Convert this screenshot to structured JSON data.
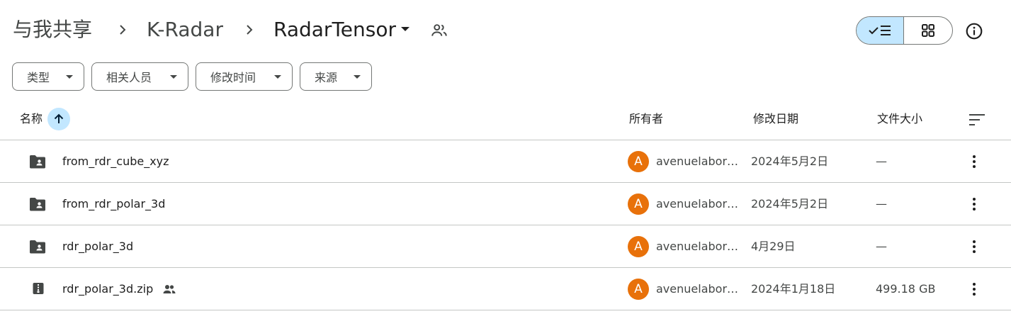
{
  "breadcrumb": {
    "items": [
      {
        "label": "与我共享"
      },
      {
        "label": "K-Radar"
      },
      {
        "label": "RadarTensor"
      }
    ]
  },
  "view_toggle": {
    "list_icon": "check-list-icon",
    "grid_icon": "grid-icon",
    "selected": "list"
  },
  "filters": [
    {
      "label": "类型"
    },
    {
      "label": "相关人员"
    },
    {
      "label": "修改时间"
    },
    {
      "label": "来源"
    }
  ],
  "columns": {
    "name": "名称",
    "owner": "所有者",
    "modified": "修改日期",
    "size": "文件大小",
    "sort": "ascending"
  },
  "files": [
    {
      "type": "shared-folder",
      "name": "from_rdr_cube_xyz",
      "shared": false,
      "owner_initial": "A",
      "owner": "avenuelaboratory",
      "modified": "2024年5月2日",
      "size": "—"
    },
    {
      "type": "shared-folder",
      "name": "from_rdr_polar_3d",
      "shared": false,
      "owner_initial": "A",
      "owner": "avenuelaboratory",
      "modified": "2024年5月2日",
      "size": "—"
    },
    {
      "type": "shared-folder",
      "name": "rdr_polar_3d",
      "shared": false,
      "owner_initial": "A",
      "owner": "avenuelaboratory",
      "modified": "4月29日",
      "size": "—"
    },
    {
      "type": "zip",
      "name": "rdr_polar_3d.zip",
      "shared": true,
      "owner_initial": "A",
      "owner": "avenuelaboratory",
      "modified": "2024年1月18日",
      "size": "499.18 GB"
    }
  ],
  "colors": {
    "accent": "#c2e7ff",
    "avatar": "#e8710a",
    "divider": "#c4c7c5"
  }
}
